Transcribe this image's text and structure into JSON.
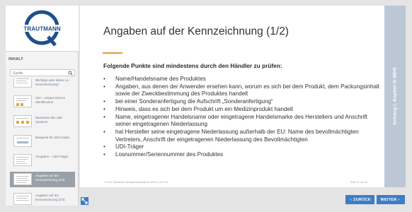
{
  "brand": {
    "logo_text": "TRAUTMANN",
    "logo_letter": "Q"
  },
  "sidebar": {
    "heading": "INHALT",
    "search_placeholder": "Suche",
    "items": [
      {
        "label": "Wichtige oder kleine Le- Kennzeichnung?",
        "active": false
      },
      {
        "label": "UDI – Unique Device Identification",
        "active": false
      },
      {
        "label": "Bausteine des UDI-Systems",
        "active": false
      },
      {
        "label": "Beispiele für UDI-Codes",
        "active": false
      },
      {
        "label": "Vorgaben – UDI-Träger",
        "active": false
      },
      {
        "label": "Angaben auf der Kennzeichnung (1/2)",
        "active": true
      },
      {
        "label": "Angaben auf der Kennzeichnung (2/2)",
        "active": false
      }
    ]
  },
  "slide": {
    "title": "Angaben auf der Kennzeichnung (1/2)",
    "subtitle": "Folgende Punkte sind mindestens durch den Händler zu prüfen:",
    "bullet_char": "•",
    "bullets": [
      "Name/Handelsname des Produktes",
      "Angaben, aus denen der Anwender ersehen kann, worum es sich bei dem Produkt, dem Packungsinhalt sowie der Zweckbestimmung des Produktes handelt",
      "bei einer Sonderanfertigung die Aufschrift „Sonderanfertigung“",
      "Hinweis, dass es sich bei dem Produkt um ein Medizinprodukt handelt",
      "Name, eingetragener Handelsname oder eingetragene Handelsmarke des Herstellers und Anschrift seiner eingetragenen Niederlassung",
      "hat Hersteller seine eingetragene Niederlassung außerhalb der EU: Name des bevollmächtigten Vertreters, Anschrift der eingetragenen Niederlassung des Bevollmächtigten",
      "UDI-Träger",
      "Losnummer/Seriennummer des Produktes"
    ],
    "copyright": "© 2021 Trautmann Managementsysteme GmbH & Co. KG",
    "page_number": "Seite 12 von 23"
  },
  "banner": {
    "text": "Anhang I, Kapitel III MDR"
  },
  "nav": {
    "back_label": "ZURÜCK",
    "next_label": "WEITER",
    "back_arrow": "‹",
    "next_arrow": "›"
  },
  "colors": {
    "accent": "#e69a3c",
    "nav_blue": "#3e7dc4",
    "banner": "#bcc7d6",
    "active_item": "#9aa0a7"
  }
}
